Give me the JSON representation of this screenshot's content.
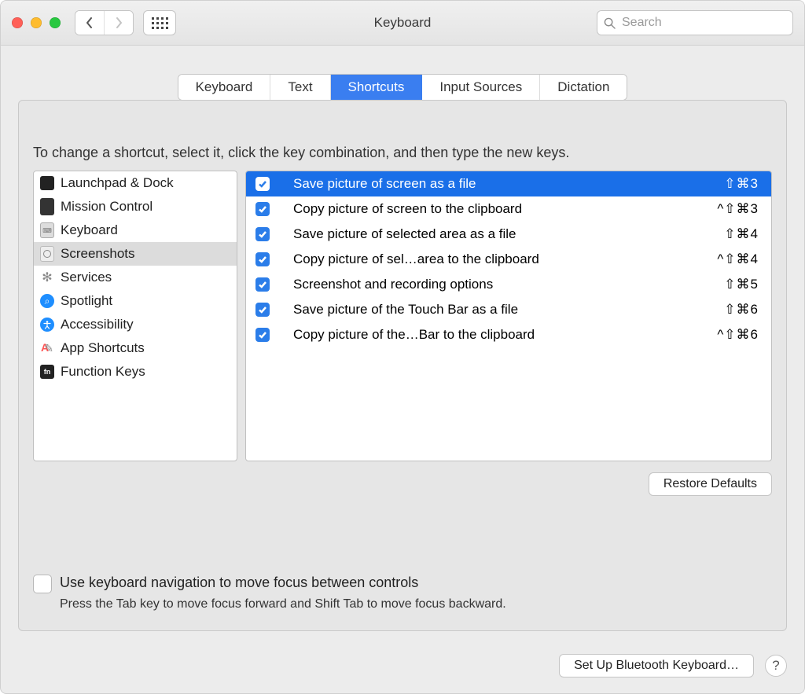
{
  "window": {
    "title": "Keyboard"
  },
  "toolbar": {
    "search_placeholder": "Search"
  },
  "tabs": [
    {
      "label": "Keyboard",
      "active": false
    },
    {
      "label": "Text",
      "active": false
    },
    {
      "label": "Shortcuts",
      "active": true
    },
    {
      "label": "Input Sources",
      "active": false
    },
    {
      "label": "Dictation",
      "active": false
    }
  ],
  "instruction": "To change a shortcut, select it, click the key combination, and then type the new keys.",
  "categories": [
    {
      "label": "Launchpad & Dock",
      "icon": "launchpad-icon",
      "selected": false
    },
    {
      "label": "Mission Control",
      "icon": "mission-control-icon",
      "selected": false
    },
    {
      "label": "Keyboard",
      "icon": "keyboard-icon",
      "selected": false
    },
    {
      "label": "Screenshots",
      "icon": "screenshots-icon",
      "selected": true
    },
    {
      "label": "Services",
      "icon": "services-icon",
      "selected": false
    },
    {
      "label": "Spotlight",
      "icon": "spotlight-icon",
      "selected": false
    },
    {
      "label": "Accessibility",
      "icon": "accessibility-icon",
      "selected": false
    },
    {
      "label": "App Shortcuts",
      "icon": "app-shortcuts-icon",
      "selected": false
    },
    {
      "label": "Function Keys",
      "icon": "function-keys-icon",
      "selected": false
    }
  ],
  "shortcuts": [
    {
      "enabled": true,
      "selected": true,
      "label": "Save picture of screen as a file",
      "keys": "⇧⌘3"
    },
    {
      "enabled": true,
      "selected": false,
      "label": "Copy picture of screen to the clipboard",
      "keys": "^⇧⌘3"
    },
    {
      "enabled": true,
      "selected": false,
      "label": "Save picture of selected area as a file",
      "keys": "⇧⌘4"
    },
    {
      "enabled": true,
      "selected": false,
      "label": "Copy picture of sel…area to the clipboard",
      "keys": "^⇧⌘4"
    },
    {
      "enabled": true,
      "selected": false,
      "label": "Screenshot and recording options",
      "keys": "⇧⌘5"
    },
    {
      "enabled": true,
      "selected": false,
      "label": "Save picture of the Touch Bar as a file",
      "keys": "⇧⌘6"
    },
    {
      "enabled": true,
      "selected": false,
      "label": "Copy picture of the…Bar to the clipboard",
      "keys": "^⇧⌘6"
    }
  ],
  "buttons": {
    "restore_defaults": "Restore Defaults",
    "bluetooth_setup": "Set Up Bluetooth Keyboard…"
  },
  "footer": {
    "checkbox_label": "Use keyboard navigation to move focus between controls",
    "hint": "Press the Tab key to move focus forward and Shift Tab to move focus backward.",
    "checkbox_checked": false
  },
  "help_label": "?"
}
